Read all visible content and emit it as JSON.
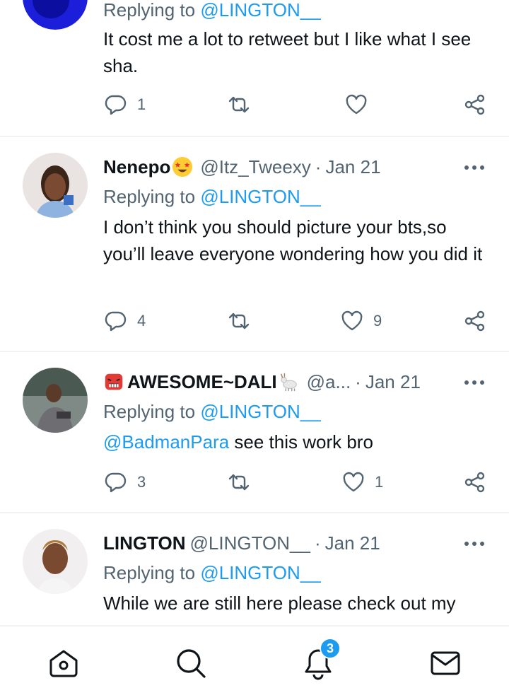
{
  "colors": {
    "accent": "#1d9bf0",
    "muted": "#536471",
    "text": "#0f1419"
  },
  "tweets": [
    {
      "replying_prefix": "Replying to",
      "replying_to": "@LINGTON__",
      "text": "It cost me a lot to retweet but I like what I see sha.",
      "reply_count": "1",
      "retweet_count": "",
      "like_count": ""
    },
    {
      "name": "Nenepo",
      "handle": "@Itz_Tweexy",
      "date": "Jan 21",
      "replying_prefix": "Replying to",
      "replying_to": "@LINGTON__",
      "text": "I don’t think you should picture your bts,so you’ll leave everyone wondering how you did it",
      "reply_count": "4",
      "retweet_count": "",
      "like_count": "9"
    },
    {
      "name": "AWESOME~DALI",
      "handle": "@a...",
      "date": "Jan 21",
      "replying_prefix": "Replying to",
      "replying_to": "@LINGTON__",
      "text_mention": "@BadmanPara",
      "text": " see this work bro",
      "reply_count": "3",
      "retweet_count": "",
      "like_count": "1"
    },
    {
      "name": "LINGTON",
      "handle": "@LINGTON__",
      "date": "Jan 21",
      "replying_prefix": "Replying to",
      "replying_to": "@LINGTON__",
      "text": "While we are still here please check out my"
    }
  ],
  "bottom_nav": {
    "items": [
      "home-icon",
      "search-icon",
      "notifications-icon",
      "messages-icon"
    ],
    "notification_badge": "3"
  }
}
